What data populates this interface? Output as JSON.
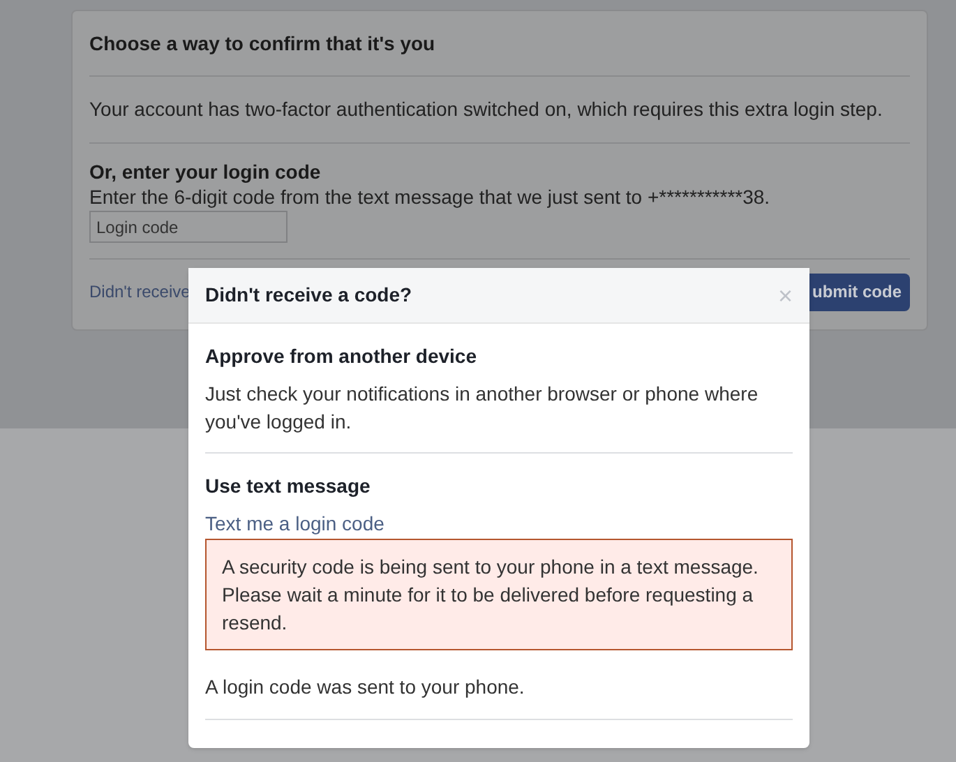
{
  "card": {
    "title": "Choose a way to confirm that it's you",
    "notice": "Your account has two-factor authentication switched on, which requires this extra login step.",
    "code_heading": "Or, enter your login code",
    "code_hint": "Enter the 6-digit code from the text message that we just sent to +***********38.",
    "code_field": {
      "placeholder": "Login code"
    },
    "help_link": "Didn't receive",
    "submit_button": "ubmit code"
  },
  "dialog": {
    "title": "Didn't receive a code?",
    "close": "×",
    "sections": [
      {
        "heading": "Approve from another device",
        "text": "Just check your notifications in another browser or phone where you've logged in."
      },
      {
        "heading": "Use text message",
        "link": "Text me a login code",
        "alert": "A security code is being sent to your phone in a text message. Please wait a minute for it to be delivered before requesting a resend.",
        "status": "A login code was sent to your phone."
      }
    ]
  }
}
